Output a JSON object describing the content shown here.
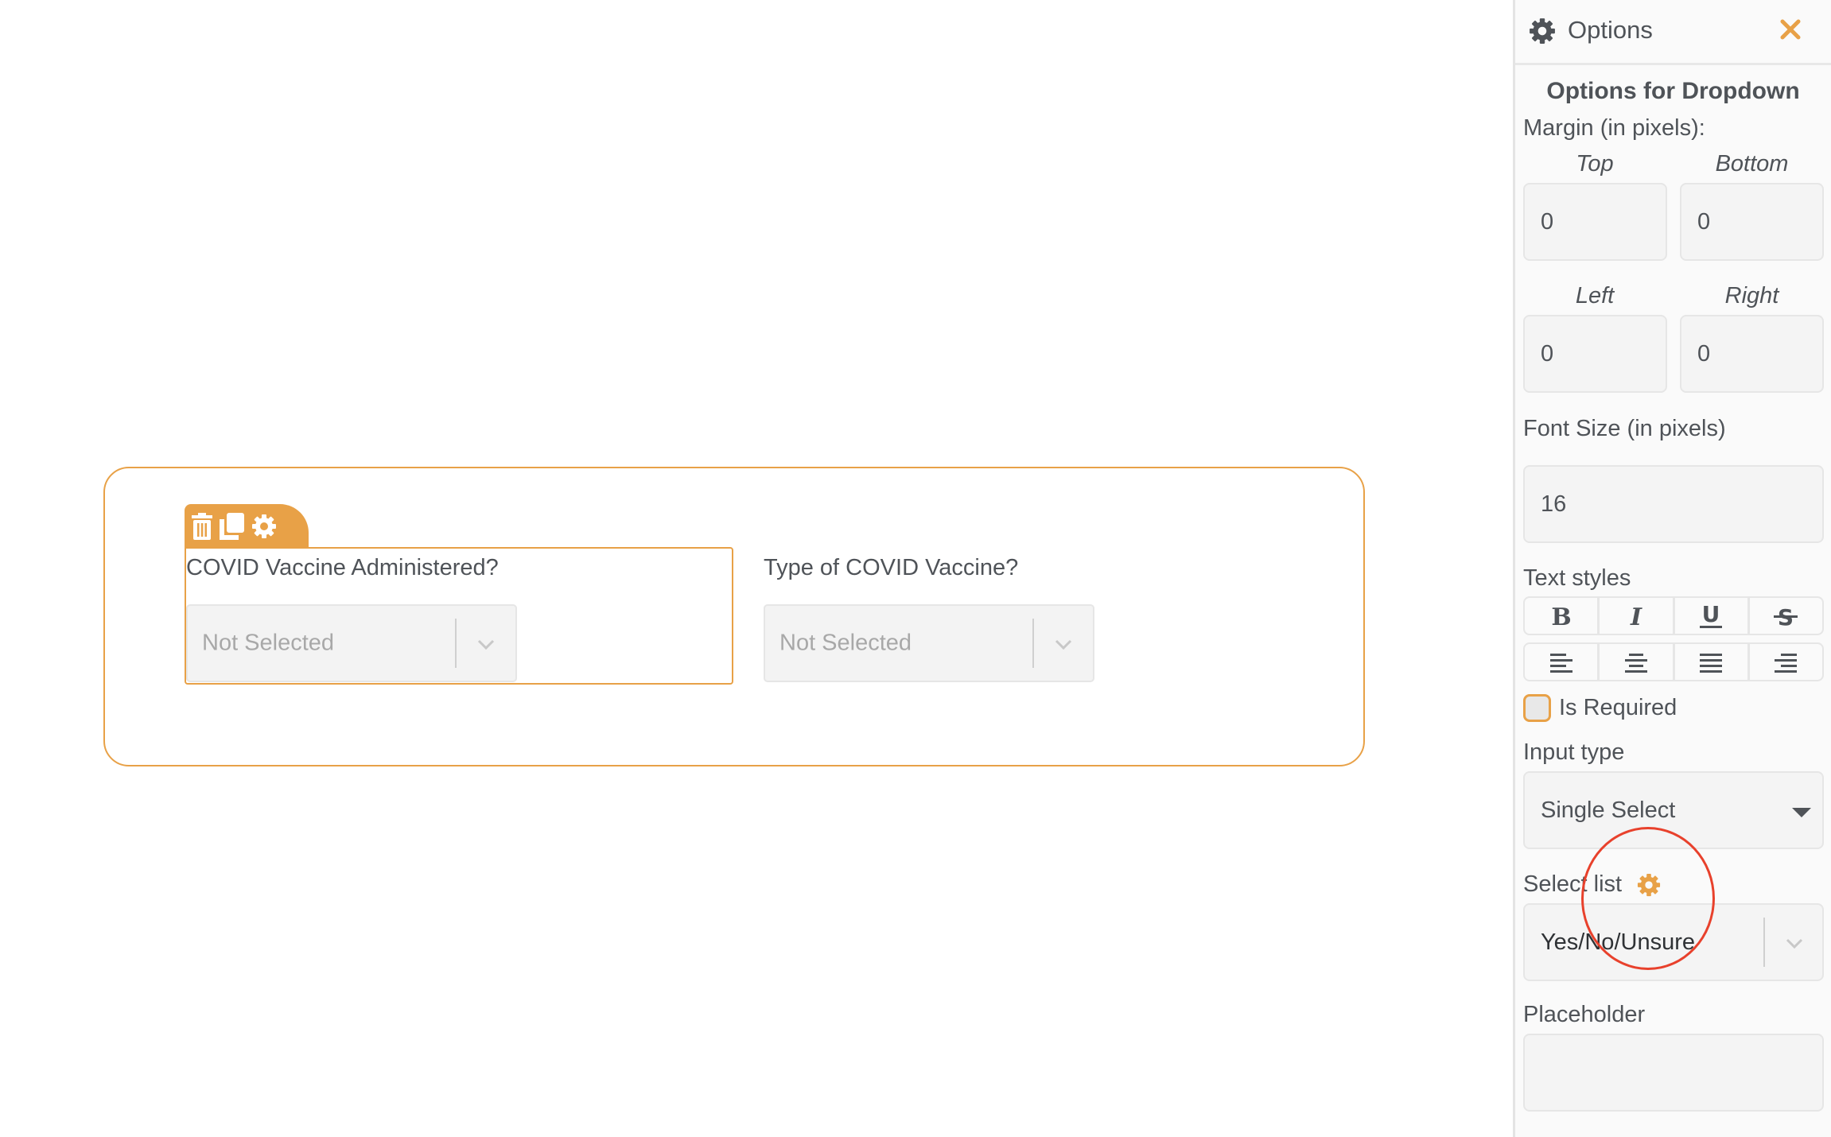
{
  "canvas": {
    "fields": [
      {
        "label": "COVID Vaccine Administered?",
        "placeholder": "Not Selected",
        "selected": true,
        "toolbar": [
          "trash-icon",
          "copy-icon",
          "gear-icon"
        ]
      },
      {
        "label": "Type of COVID Vaccine?",
        "placeholder": "Not Selected",
        "selected": false
      }
    ]
  },
  "panel": {
    "title": "Options",
    "subtitle": "Options for Dropdown",
    "margin_label": "Margin (in pixels):",
    "margins": {
      "top_label": "Top",
      "top_value": "0",
      "bottom_label": "Bottom",
      "bottom_value": "0",
      "left_label": "Left",
      "left_value": "0",
      "right_label": "Right",
      "right_value": "0"
    },
    "font_size_label": "Font Size (in pixels)",
    "font_size_value": "16",
    "text_styles_label": "Text styles",
    "text_styles": [
      "bold",
      "italic",
      "underline",
      "strikethrough"
    ],
    "alignments": [
      "align-left",
      "align-center",
      "align-justify",
      "align-right"
    ],
    "is_required_label": "Is Required",
    "is_required": false,
    "input_type_label": "Input type",
    "input_type_value": "Single Select",
    "select_list_label": "Select list",
    "select_list_value": "Yes/No/Unsure",
    "placeholder_label": "Placeholder",
    "placeholder_value": ""
  },
  "colors": {
    "accent": "#e8a147",
    "annotation": "#e8412c",
    "text": "#4f5358"
  }
}
